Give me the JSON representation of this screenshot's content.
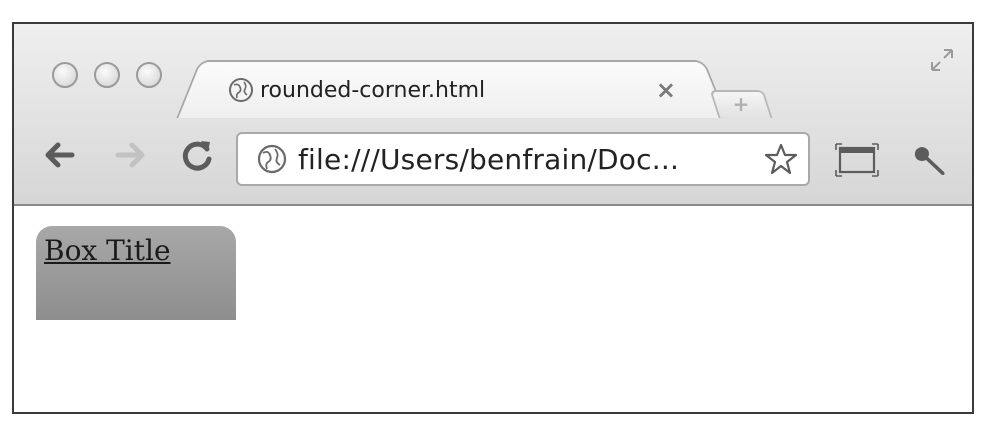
{
  "tab": {
    "title": "rounded-corner.html",
    "close_glyph": "×",
    "icon": "globe-icon"
  },
  "new_tab": {
    "glyph": "+"
  },
  "toolbar": {
    "back_icon": "back-arrow-icon",
    "forward_icon": "forward-arrow-icon",
    "reload_icon": "reload-icon",
    "url": "file:///Users/benfrain/Doc...",
    "bookmark_icon": "star-icon",
    "page_action_icon": "page-mode-icon",
    "settings_icon": "wrench-icon"
  },
  "content": {
    "box_title": "Box Title"
  },
  "colors": {
    "box_gradient_top": "#a8a8a8",
    "box_gradient_bottom": "#8e8e8e",
    "chrome_top": "#efefef",
    "chrome_bottom": "#d6d6d6"
  }
}
